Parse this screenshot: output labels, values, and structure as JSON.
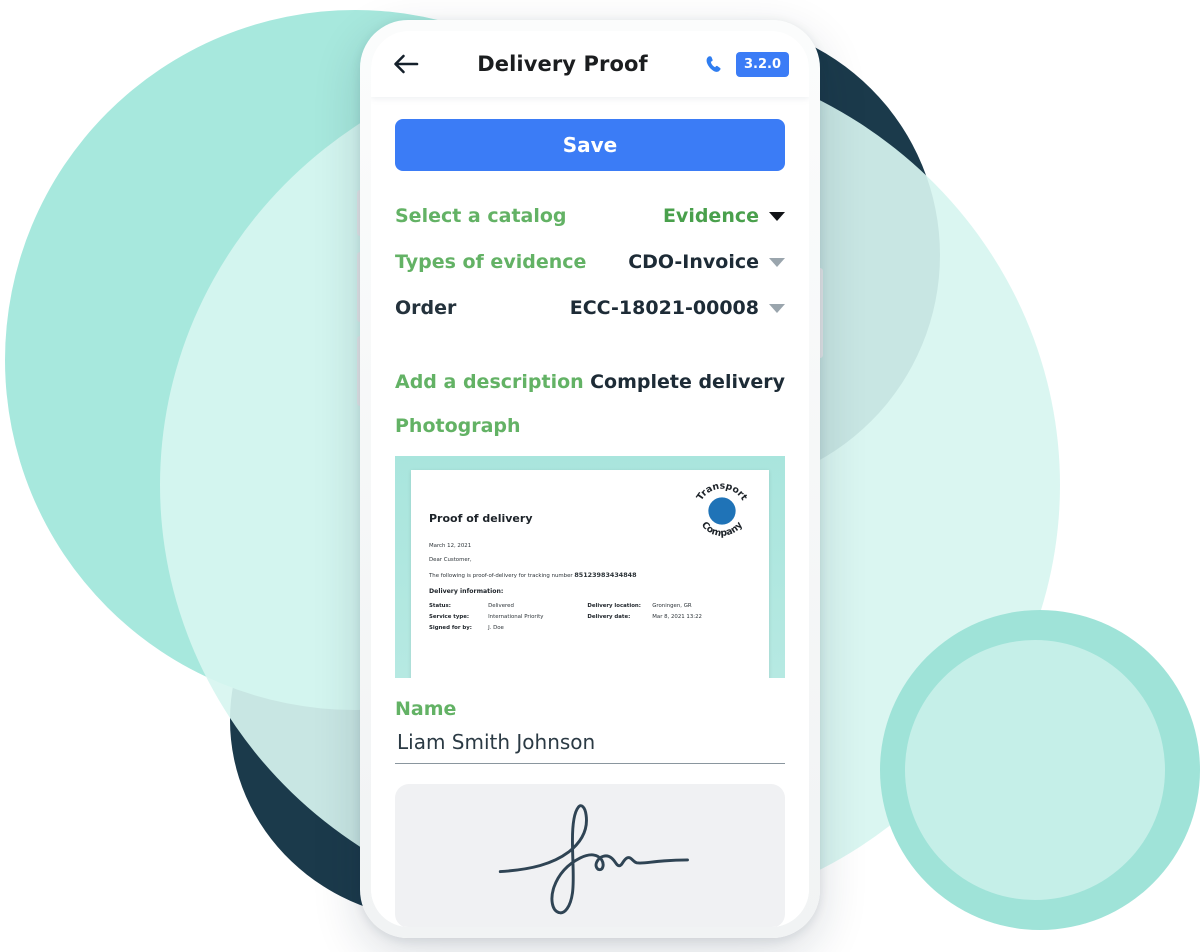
{
  "appbar": {
    "back_icon": "arrow-left-icon",
    "title": "Delivery Proof",
    "call_icon": "phone-call-icon",
    "version": "3.2.0"
  },
  "actions": {
    "save_label": "Save"
  },
  "form": {
    "catalog": {
      "label": "Select a catalog",
      "value": "Evidence",
      "caret": "chevron-down-icon"
    },
    "evidence_type": {
      "label": "Types of evidence",
      "value": "CDO-Invoice",
      "caret": "chevron-down-icon"
    },
    "order": {
      "label": "Order",
      "value": "ECC-18021-00008",
      "caret": "chevron-down-icon"
    },
    "description": {
      "label": "Add a description",
      "value": "Complete delivery"
    },
    "photograph": {
      "label": "Photograph"
    },
    "name": {
      "label": "Name",
      "value": "Liam Smith Johnson",
      "placeholder": "Name"
    }
  },
  "document": {
    "title": "Proof of delivery",
    "logo_text_top": "Transport",
    "logo_text_bottom": "Company",
    "date": "March 12, 2021",
    "salutation": "Dear Customer,",
    "intro": "The following is proof-of-delivery for tracking number",
    "tracking_number": "85123983434848",
    "section_title": "Delivery information:",
    "rows": [
      {
        "key": "Status:",
        "value": "Delivered",
        "key2": "Delivery location:",
        "value2": "Groningen, GR"
      },
      {
        "key": "Service type:",
        "value": "International Priority",
        "key2": "Delivery date:",
        "value2": "Mar 8, 2021 13:22"
      },
      {
        "key": "Signed for by:",
        "value": "J. Doe",
        "key2": "",
        "value2": ""
      }
    ]
  },
  "signature": {
    "pad_name": "signature-pad",
    "has_signature": true
  },
  "colors": {
    "accent_blue": "#3b7cf6",
    "label_green": "#63b265",
    "text_dark": "#1d2b36",
    "teal": "#a7e8dd",
    "navy": "#1b3a4b"
  }
}
